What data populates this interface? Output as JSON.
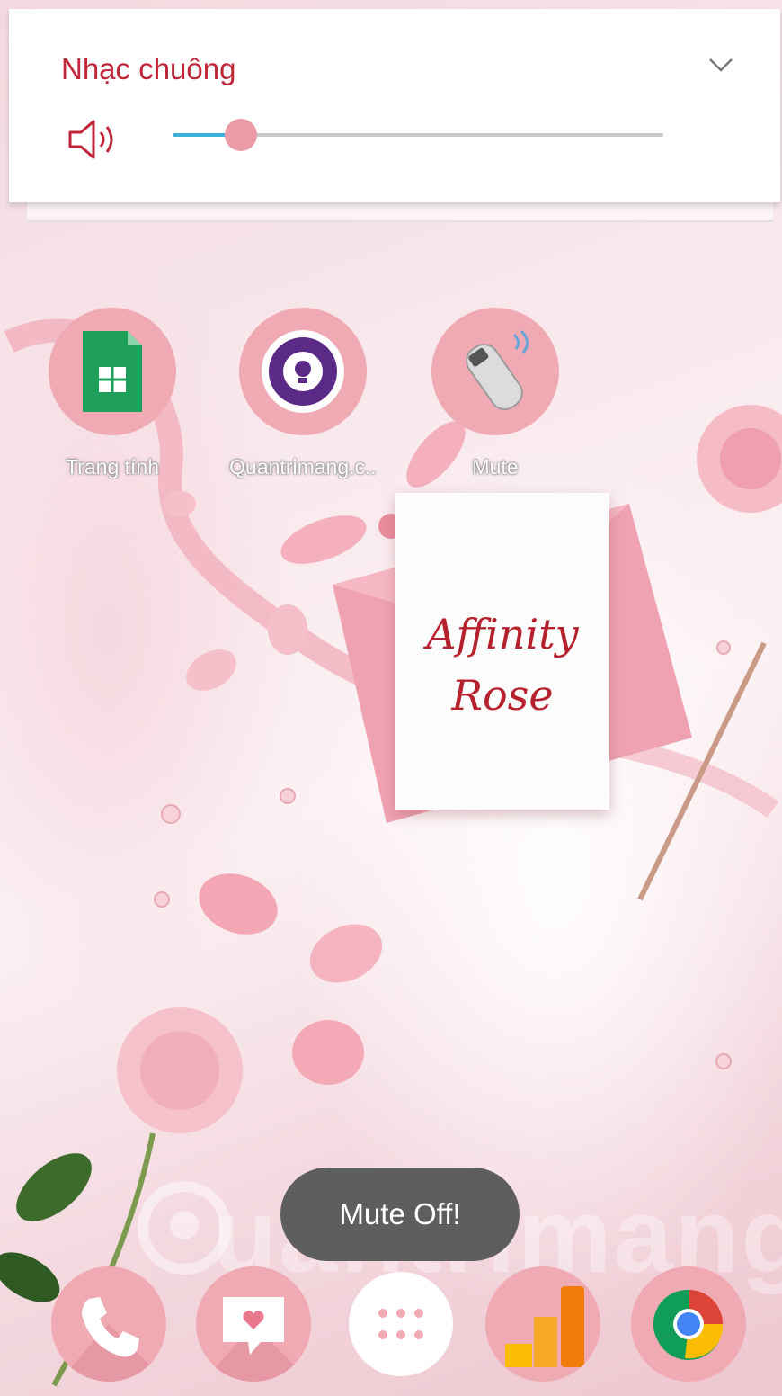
{
  "volume": {
    "title": "Nhạc chuông",
    "level_fraction": 0.14
  },
  "apps": [
    {
      "label": "Trang tính",
      "icon": "sheets-icon"
    },
    {
      "label": "Quantrimang.c..",
      "icon": "quantrimang-icon"
    },
    {
      "label": "Mute",
      "icon": "mute-icon"
    }
  ],
  "wallpaper": {
    "line1": "Affinity",
    "line2": "Rose"
  },
  "toast": "Mute Off!",
  "watermark": "uantrimang",
  "dock": [
    {
      "icon": "phone-icon"
    },
    {
      "icon": "messages-icon"
    },
    {
      "icon": "apps-grid-icon"
    },
    {
      "icon": "analytics-icon"
    },
    {
      "icon": "chrome-icon"
    }
  ],
  "colors": {
    "accent": "#c0263a",
    "slider": "#3db0d9",
    "thumb": "#eb9ba6",
    "icon_bg": "#f0aab4"
  }
}
